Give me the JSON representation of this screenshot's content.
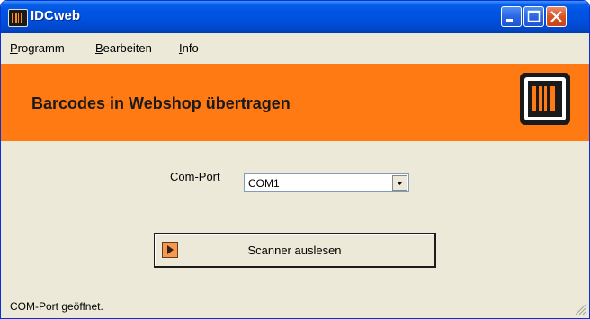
{
  "window": {
    "title": "IDCweb",
    "icon": "barcode-app-icon"
  },
  "titlebar_buttons": [
    "minimize-icon",
    "maximize-icon",
    "close-icon"
  ],
  "menu": {
    "items": [
      "Programm",
      "Bearbeiten",
      "Info"
    ]
  },
  "banner": {
    "title": "Barcodes in Webshop übertragen",
    "logo": "barcode-logo-icon",
    "color": "#ff7a12"
  },
  "form": {
    "com_port_label": "Com-Port",
    "com_port_value": "COM1"
  },
  "scan_button": {
    "label": "Scanner auslesen",
    "icon": "play-arrow-icon"
  },
  "status": {
    "text": "COM-Port geöffnet."
  }
}
